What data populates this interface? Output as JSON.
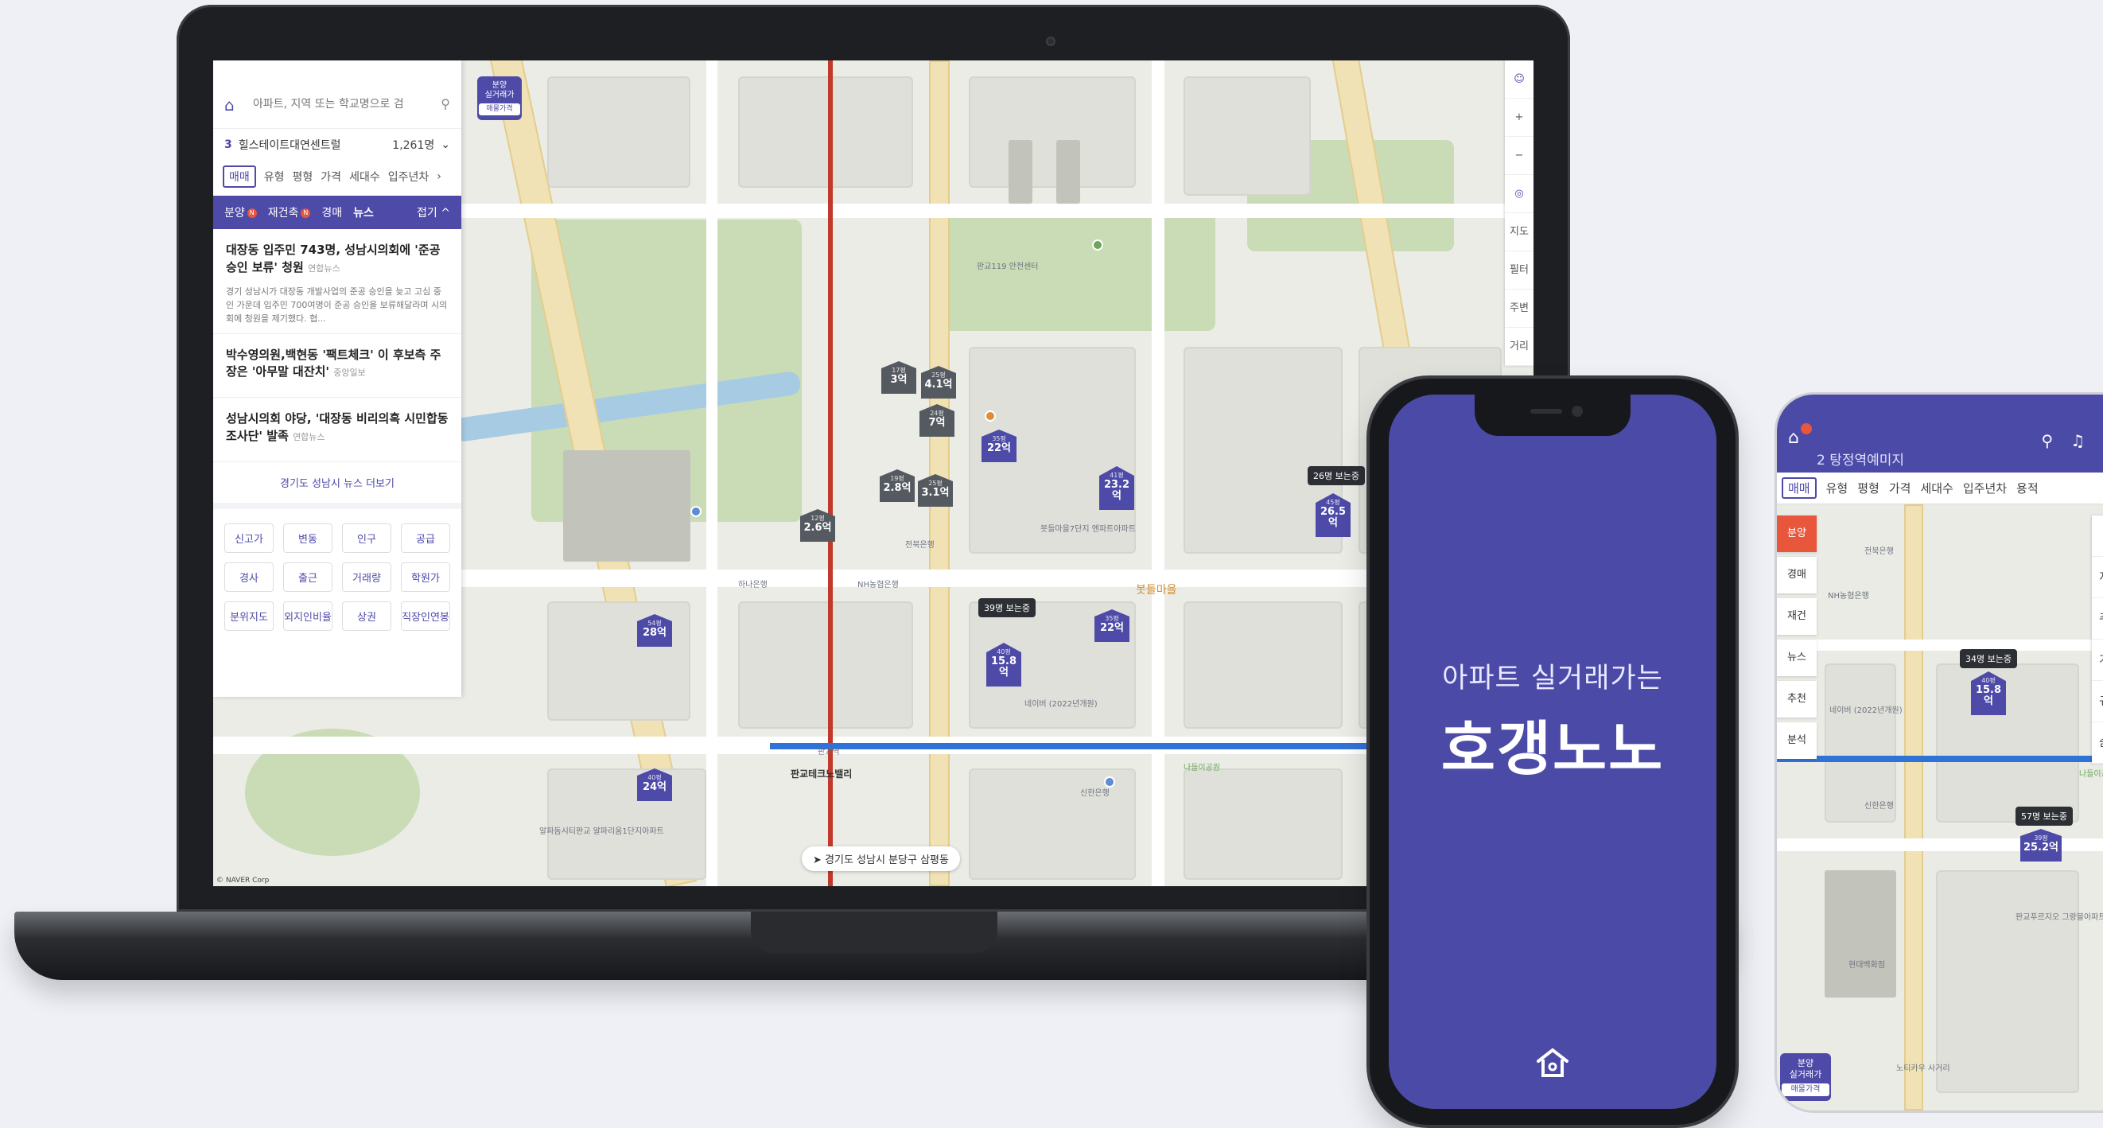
{
  "laptop": {
    "search": {
      "placeholder": "아파트, 지역 또는 학교명으로 검"
    },
    "compare": {
      "num": "3",
      "name": "힐스테이트대연센트럴",
      "count": "1,261명"
    },
    "filters": [
      "매매",
      "유형",
      "평형",
      "가격",
      "세대수",
      "입주년차"
    ],
    "news_tabs": [
      "분양",
      "재건축",
      "경매",
      "뉴스"
    ],
    "news_fold": "접기",
    "news": [
      {
        "title": "대장동 입주민 743명, 성남시의회에 '준공 승인 보류' 청원",
        "source": "연합뉴스",
        "body": "경기 성남시가 대장동 개발사업의 준공 승인을 늦고 고심 중인 가운데 입주민 700여명이 준공 승인을 보류해달라며 시의회에 청원을 제기했다. 협..."
      },
      {
        "title": "박수영의원,백현동 '팩트체크' 이 후보측 주장은 '아무말 대잔치'",
        "source": "중앙일보",
        "body": ""
      },
      {
        "title": "성남시의회 야당, '대장동 비리의혹 시민합동조사단' 발족",
        "source": "연합뉴스",
        "body": ""
      }
    ],
    "news_more": "경기도 성남시 뉴스 더보기",
    "grid": [
      "신고가",
      "변동",
      "인구",
      "공급",
      "경사",
      "출근",
      "거래량",
      "학원가",
      "분위지도",
      "외지인비율",
      "상권",
      "직장인연봉"
    ],
    "side_tag": {
      "line1": "분양",
      "line2": "실거래가",
      "btn": "매물가격"
    },
    "controls": [
      "지도",
      "필터",
      "주변",
      "거리"
    ],
    "address": "경기도 성남시 분당구 삼평동",
    "naver": "© NAVER Corp",
    "markers": [
      {
        "sub": "54평",
        "price": "28억"
      },
      {
        "sub": "40평",
        "price": "24억"
      },
      {
        "sub": "17평",
        "price": "3억"
      },
      {
        "sub": "25평",
        "price": "4.1억"
      },
      {
        "sub": "24평",
        "price": "7억"
      },
      {
        "sub": "35평",
        "price": "22억"
      },
      {
        "sub": "19평",
        "price": "2.8억"
      },
      {
        "sub": "25평",
        "price": "3.1억"
      },
      {
        "sub": "12평",
        "price": "2.6억"
      },
      {
        "sub": "41평",
        "price": "23.2억"
      },
      {
        "sub": "45평",
        "price": "26.5억"
      },
      {
        "sub": "35평",
        "price": "22억"
      },
      {
        "sub": "40평",
        "price": "15.8억"
      }
    ],
    "viewers": [
      "39명 보는중",
      "26명 보는중"
    ],
    "map_labels": [
      "판교테크노밸리",
      "판교역",
      "NH농협은행",
      "봇들마을",
      "신한은행",
      "하나은행",
      "전북은행",
      "나들이공원",
      "알파돔시티판교 알파리움1단지아파트",
      "네이버 (2022년개원)",
      "봇들마을7단지 엔파트아파트",
      "판교119 안전센터"
    ]
  },
  "phone1": {
    "subtitle": "아파트 실거래가는",
    "title": "호갱노노"
  },
  "phone2": {
    "title": "2 탕정역예미지",
    "filters": [
      "매매",
      "유형",
      "평형",
      "가격",
      "세대수",
      "입주년차",
      "용적"
    ],
    "left": [
      "분양",
      "경매",
      "재건",
      "뉴스",
      "추천",
      "분석"
    ],
    "right": [
      "지도",
      "주변",
      "거리",
      "규제",
      "숨김"
    ],
    "viewers": "34명 보는중",
    "viewers2": "57명 보는중",
    "markers": [
      {
        "sub": "40평",
        "price": "15.8억"
      },
      {
        "sub": "39평",
        "price": "25.2억"
      }
    ],
    "tag": {
      "line1": "분양",
      "line2": "실거래가",
      "btn": "매물가격"
    },
    "labels": [
      "NH농협은행",
      "전북은행",
      "신한은행",
      "네이버 (2022년개원)",
      "판교푸르지오 그랑블아파트",
      "현대백화점",
      "노티카우 사거리",
      "나들이공원"
    ]
  },
  "colors": {
    "brand": "#4b4ba7",
    "accent_red": "#e8563b",
    "line_red": "#c0392b",
    "line_blue": "#2f73d8"
  }
}
